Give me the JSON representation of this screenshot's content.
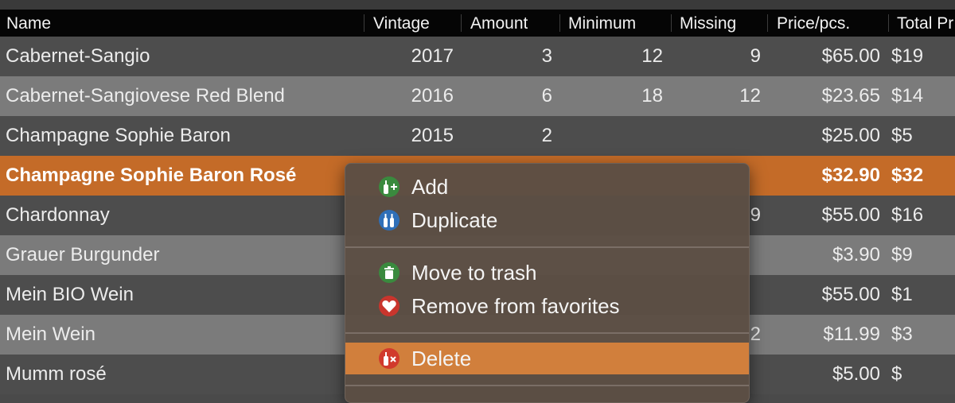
{
  "columns": {
    "name": "Name",
    "vintage": "Vintage",
    "amount": "Amount",
    "minimum": "Minimum",
    "missing": "Missing",
    "price": "Price/pcs.",
    "total": "Total Pr"
  },
  "rows": [
    {
      "name": "Cabernet-Sangio",
      "vintage": "2017",
      "amount": "3",
      "minimum": "12",
      "missing": "9",
      "price": "$65.00",
      "total": "$19"
    },
    {
      "name": "Cabernet-Sangiovese Red Blend",
      "vintage": "2016",
      "amount": "6",
      "minimum": "18",
      "missing": "12",
      "price": "$23.65",
      "total": "$14"
    },
    {
      "name": "Champagne Sophie Baron",
      "vintage": "2015",
      "amount": "2",
      "minimum": "",
      "missing": "",
      "price": "$25.00",
      "total": "$5"
    },
    {
      "name": "Champagne Sophie Baron Rosé",
      "vintage": "",
      "amount": "",
      "minimum": "",
      "missing": "",
      "price": "$32.90",
      "total": "$32"
    },
    {
      "name": "Chardonnay",
      "vintage": "",
      "amount": "",
      "minimum": "",
      "missing": "9",
      "price": "$55.00",
      "total": "$16"
    },
    {
      "name": "Grauer Burgunder",
      "vintage": "",
      "amount": "",
      "minimum": "",
      "missing": "",
      "price": "$3.90",
      "total": "$9"
    },
    {
      "name": "Mein BIO Wein",
      "vintage": "",
      "amount": "",
      "minimum": "",
      "missing": "",
      "price": "$55.00",
      "total": "$1"
    },
    {
      "name": "Mein Wein",
      "vintage": "",
      "amount": "",
      "minimum": "",
      "missing": "2",
      "price": "$11.99",
      "total": "$3"
    },
    {
      "name": "Mumm rosé",
      "vintage": "",
      "amount": "",
      "minimum": "",
      "missing": "",
      "price": "$5.00",
      "total": "$"
    }
  ],
  "selected_row": 3,
  "context_menu": {
    "items": [
      {
        "label": "Add",
        "icon": "bottle-add-icon",
        "color": "#3a8a3e"
      },
      {
        "label": "Duplicate",
        "icon": "bottles-duplicate-icon",
        "color": "#2f6fb8"
      },
      {
        "label": "Move to trash",
        "icon": "trash-bin-icon",
        "color": "#3a8a3e"
      },
      {
        "label": "Remove from favorites",
        "icon": "heart-icon",
        "color": "#c9352d"
      },
      {
        "label": "Delete",
        "icon": "bottle-delete-icon",
        "color": "#d13a2c"
      }
    ],
    "active_item": 4
  },
  "colors": {
    "selection": "#c46b28",
    "menu_highlight": "#d17f3c"
  }
}
